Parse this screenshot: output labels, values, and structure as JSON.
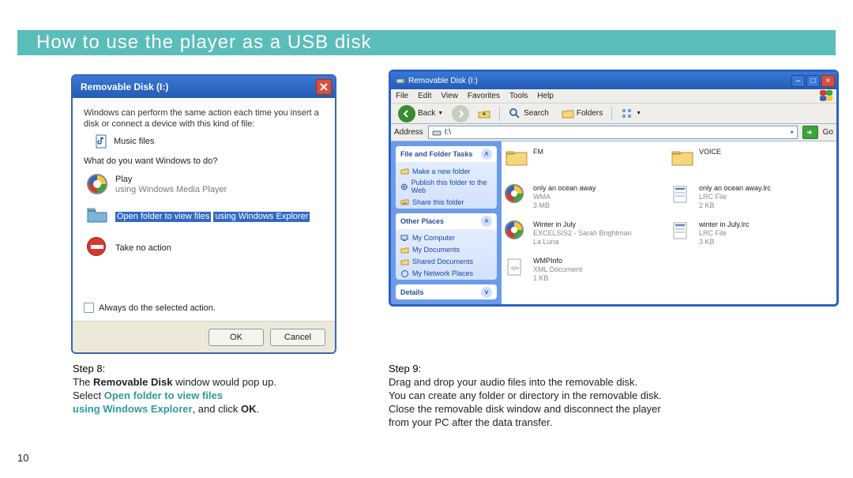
{
  "page": {
    "title": "How to use the player as a USB disk",
    "number": "10"
  },
  "dialog": {
    "title": "Removable Disk (I:)",
    "message": "Windows can perform the same action each time you insert a disk or connect a device with this kind of file:",
    "file_kind": "Music files",
    "prompt": "What do you want Windows to do?",
    "options": [
      {
        "line1": "Play",
        "line2": "using Windows Media Player",
        "icon": "wmp-icon"
      },
      {
        "line1": "Open folder to view files",
        "line2": "using Windows Explorer",
        "icon": "folder-icon"
      },
      {
        "line1": "Take no action",
        "line2": "",
        "icon": "noentry-icon"
      }
    ],
    "always_label": "Always do the selected action.",
    "ok_label": "OK",
    "cancel_label": "Cancel"
  },
  "explorer": {
    "title": "Removable Disk (I:)",
    "menu": [
      "File",
      "Edit",
      "View",
      "Favorites",
      "Tools",
      "Help"
    ],
    "toolbar": {
      "back": "Back",
      "search": "Search",
      "folders": "Folders"
    },
    "address_label": "Address",
    "address_value": "I:\\",
    "go_label": "Go",
    "side": {
      "tasks_title": "File and Folder Tasks",
      "tasks": [
        "Make a new folder",
        "Publish this folder to the Web",
        "Share this folder"
      ],
      "places_title": "Other Places",
      "places": [
        "My Computer",
        "My Documents",
        "Shared Documents",
        "My Network Places"
      ],
      "details_title": "Details"
    },
    "items": [
      {
        "name": "FM",
        "type": "folder",
        "meta": ""
      },
      {
        "name": "VOICE",
        "type": "folder",
        "meta": ""
      },
      {
        "name": "only an ocean away",
        "type": "audio",
        "meta": "WMA\n3 MB"
      },
      {
        "name": "only an ocean away.lrc",
        "type": "lrc",
        "meta": "LRC File\n2 KB"
      },
      {
        "name": "Winter in July",
        "type": "audio",
        "meta": "EXCELSIS2 - Sarah Brightman\nLa Luna"
      },
      {
        "name": "winter in July.lrc",
        "type": "lrc",
        "meta": "LRC File\n3 KB"
      },
      {
        "name": "WMPInfo",
        "type": "xml",
        "meta": "XML Document\n1 KB"
      }
    ]
  },
  "captions": {
    "step8_label": "Step 8:",
    "step8_l1a": "The ",
    "step8_l1b": "Removable Disk",
    "step8_l1c": " window would pop up.",
    "step8_l2a": "Select ",
    "step8_l2b": "Open folder to view files",
    "step8_l3a": "using Windows Explorer",
    "step8_l3b": ", and click ",
    "step8_l3c": "OK",
    "step8_l3d": ".",
    "step9_label": "Step 9:",
    "step9_l1": "Drag and drop your audio files into the removable disk.",
    "step9_l2": "You can create any folder or directory in the removable disk.",
    "step9_l3": "Close the removable disk window and disconnect the player",
    "step9_l4": "from your PC after the data transfer."
  }
}
